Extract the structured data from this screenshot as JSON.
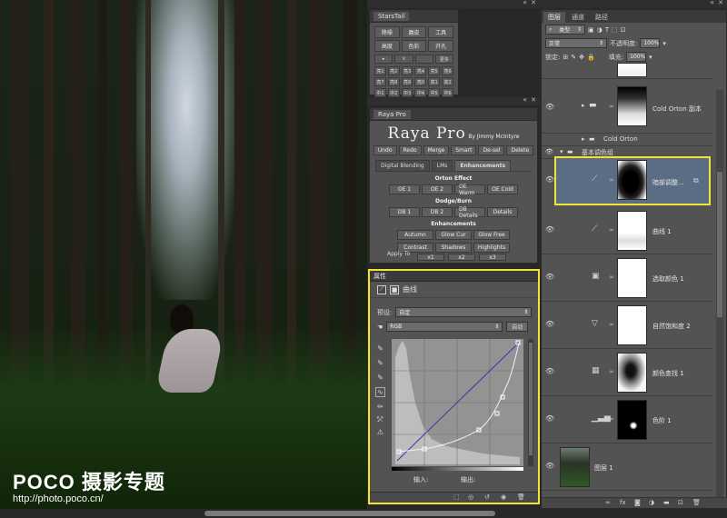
{
  "photo": {
    "watermark_title": "POCO 摄影专题",
    "watermark_url": "http://photo.poco.cn/"
  },
  "starstail": {
    "title": "StarsTail",
    "row1": [
      "降噪",
      "磨皮",
      "工具"
    ],
    "row2": [
      "高度",
      "色彩",
      "开孔"
    ],
    "row3": [
      "▸",
      "×",
      "",
      "更多"
    ],
    "small": [
      "亮1",
      "亮2",
      "亮3",
      "亮4",
      "亮5",
      "亮6",
      "亮7",
      "亮8",
      "亮9",
      "亮0",
      "高1",
      "高2",
      "中1",
      "中2",
      "中3",
      "中4",
      "中5",
      "中6"
    ]
  },
  "raya": {
    "title": "Raya Pro",
    "logo": "Raya Pro",
    "by": "By Jimmy McIntyre",
    "top_buttons": [
      "Undo",
      "Redo",
      "Merge",
      "Smart",
      "De-sel",
      "Delete"
    ],
    "tabs": [
      "Digital Blending",
      "LMs",
      "Enhancements"
    ],
    "orton_header": "Orton Effect",
    "orton": [
      "OE 1",
      "OE 2",
      "OE Warm",
      "OE Cold"
    ],
    "dodge_header": "Dodge/Burn",
    "dodge": [
      "DB 1",
      "DB 2",
      "DB Details",
      "Details"
    ],
    "enh_header": "Enhancements",
    "enh1": [
      "Autumn",
      "Glow Cur",
      "Glow Free"
    ],
    "enh2": [
      "Contrast",
      "Shadows",
      "Highlights"
    ],
    "apply_to": "Apply To",
    "apply_buttons": [
      "x1",
      "x2",
      "x3"
    ]
  },
  "properties": {
    "title": "属性",
    "type_label": "曲线",
    "preset_label": "预设:",
    "preset_value": "自定",
    "channel_value": "RGB",
    "auto_label": "自动",
    "input_label": "输入:",
    "output_label": "输出:"
  },
  "layers": {
    "tabs": [
      "图层",
      "通道",
      "路径"
    ],
    "kind_label": "类型",
    "blend_mode": "正常",
    "opacity_label": "不透明度:",
    "opacity_value": "100%",
    "lock_label": "锁定:",
    "fill_label": "填充:",
    "fill_value": "100%",
    "items": [
      {
        "name": "Cold Orton 副本"
      },
      {
        "name": "Cold Orton"
      },
      {
        "name": "基本调色组"
      },
      {
        "name": "暗部调整..."
      },
      {
        "name": "曲线 1"
      },
      {
        "name": "选取颜色 1"
      },
      {
        "name": "自然饱和度 2"
      },
      {
        "name": "颜色查找 1"
      },
      {
        "name": "色阶 1"
      },
      {
        "name": "图层 1"
      }
    ]
  },
  "colors": {
    "highlight": "#f1e531",
    "selected_layer": "#5b6d84",
    "panel": "#535353"
  }
}
